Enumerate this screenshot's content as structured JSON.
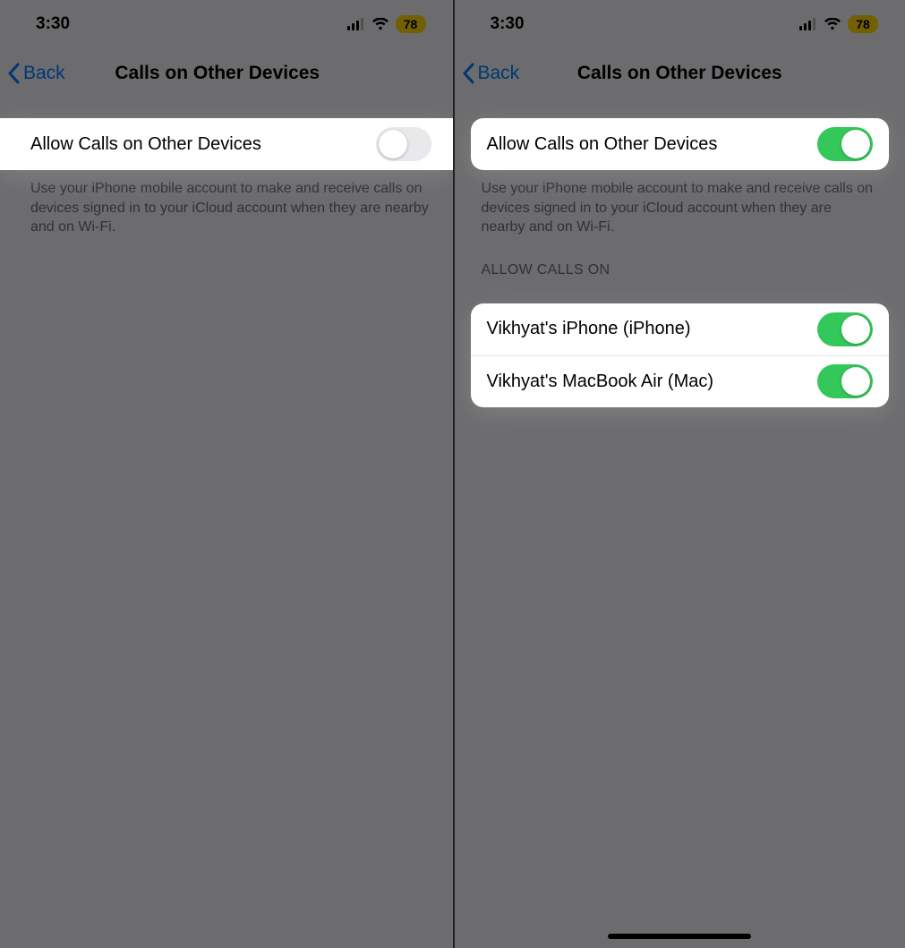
{
  "status": {
    "time": "3:30",
    "battery": "78"
  },
  "nav": {
    "back": "Back",
    "title": "Calls on Other Devices"
  },
  "main_toggle": {
    "label": "Allow Calls on Other Devices"
  },
  "footer": "Use your iPhone mobile account to make and receive calls on devices signed in to your iCloud account when they are nearby and on Wi-Fi.",
  "devices_header": "ALLOW CALLS ON",
  "devices": [
    {
      "label": "Vikhyat's iPhone (iPhone)"
    },
    {
      "label": "Vikhyat's MacBook Air (Mac)"
    }
  ],
  "toggle_states": {
    "left_main": false,
    "right_main": true,
    "right_dev0": true,
    "right_dev1": true
  },
  "colors": {
    "accent": "#007aff",
    "switch_on": "#34c759",
    "battery_bg": "#ffd60a"
  }
}
